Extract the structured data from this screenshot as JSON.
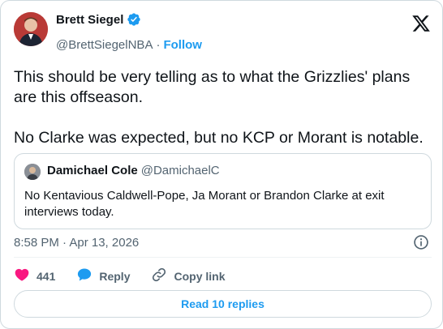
{
  "author": {
    "name": "Brett Siegel",
    "handle": "@BrettSiegelNBA",
    "separator": "·",
    "follow_label": "Follow"
  },
  "tweet": {
    "text": "This should be very telling as to what the Grizzlies' plans are this offseason.\n\nNo Clarke was expected, but no KCP or Morant is notable."
  },
  "quoted": {
    "name": "Damichael Cole",
    "handle": "@DamichaelC",
    "text": "No Kentavious Caldwell-Pope, Ja Morant or Brandon Clarke at exit interviews today."
  },
  "meta": {
    "timestamp": "8:58 PM · Apr 13, 2026"
  },
  "actions": {
    "likes": "441",
    "reply_label": "Reply",
    "copy_link_label": "Copy link"
  },
  "footer": {
    "read_replies_label": "Read 10 replies"
  },
  "colors": {
    "accent": "#1d9bf0",
    "like": "#f91880",
    "text_primary": "#0f1419",
    "text_secondary": "#536471",
    "border": "#cfd9de"
  },
  "icons": [
    "verified-badge-icon",
    "x-logo-icon",
    "info-icon",
    "heart-icon",
    "reply-bubble-icon",
    "link-icon"
  ]
}
